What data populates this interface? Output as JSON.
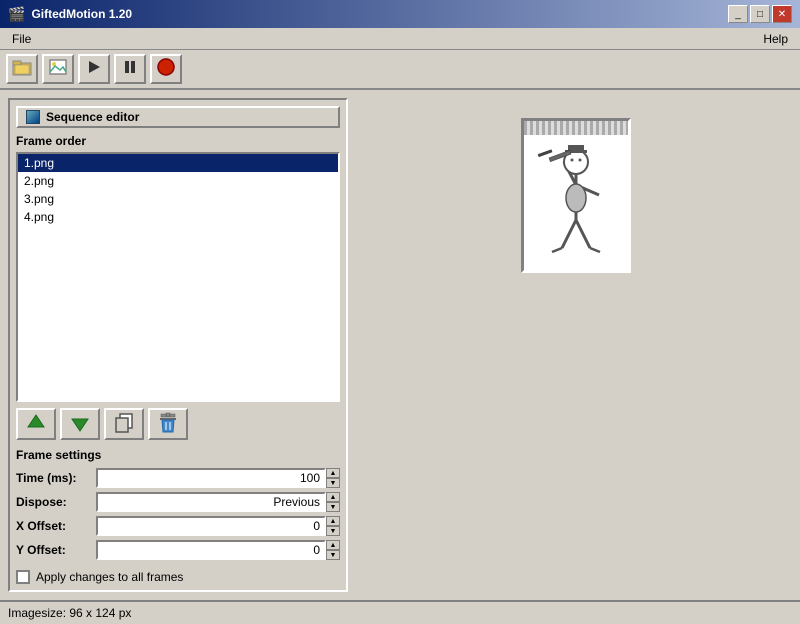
{
  "window": {
    "title": "GiftedMotion 1.20",
    "icon": "🎬"
  },
  "titlebar_controls": {
    "minimize": "_",
    "maximize": "□",
    "close": "✕"
  },
  "menu": {
    "file_label": "File",
    "help_label": "Help"
  },
  "toolbar": {
    "open_icon": "open-folder-icon",
    "image_icon": "image-icon",
    "play_icon": "play-icon",
    "pause_icon": "pause-icon",
    "record_icon": "record-icon"
  },
  "sequence_editor": {
    "title": "Sequence editor",
    "frame_order_label": "Frame order",
    "frames": [
      {
        "name": "1.png",
        "selected": true
      },
      {
        "name": "2.png",
        "selected": false
      },
      {
        "name": "3.png",
        "selected": false
      },
      {
        "name": "4.png",
        "selected": false
      }
    ],
    "buttons": {
      "move_up_label": "move-up",
      "move_down_label": "move-down",
      "copy_label": "copy",
      "delete_label": "delete"
    },
    "frame_settings_label": "Frame settings",
    "settings": {
      "time_label": "Time (ms):",
      "time_value": "100",
      "dispose_label": "Dispose:",
      "dispose_value": "Previous",
      "x_offset_label": "X Offset:",
      "x_offset_value": "0",
      "y_offset_label": "Y Offset:",
      "y_offset_value": "0"
    },
    "apply_checkbox_label": "Apply changes to all frames",
    "apply_checked": false
  },
  "status_bar": {
    "text": "Imagesize: 96 x 124 px"
  }
}
